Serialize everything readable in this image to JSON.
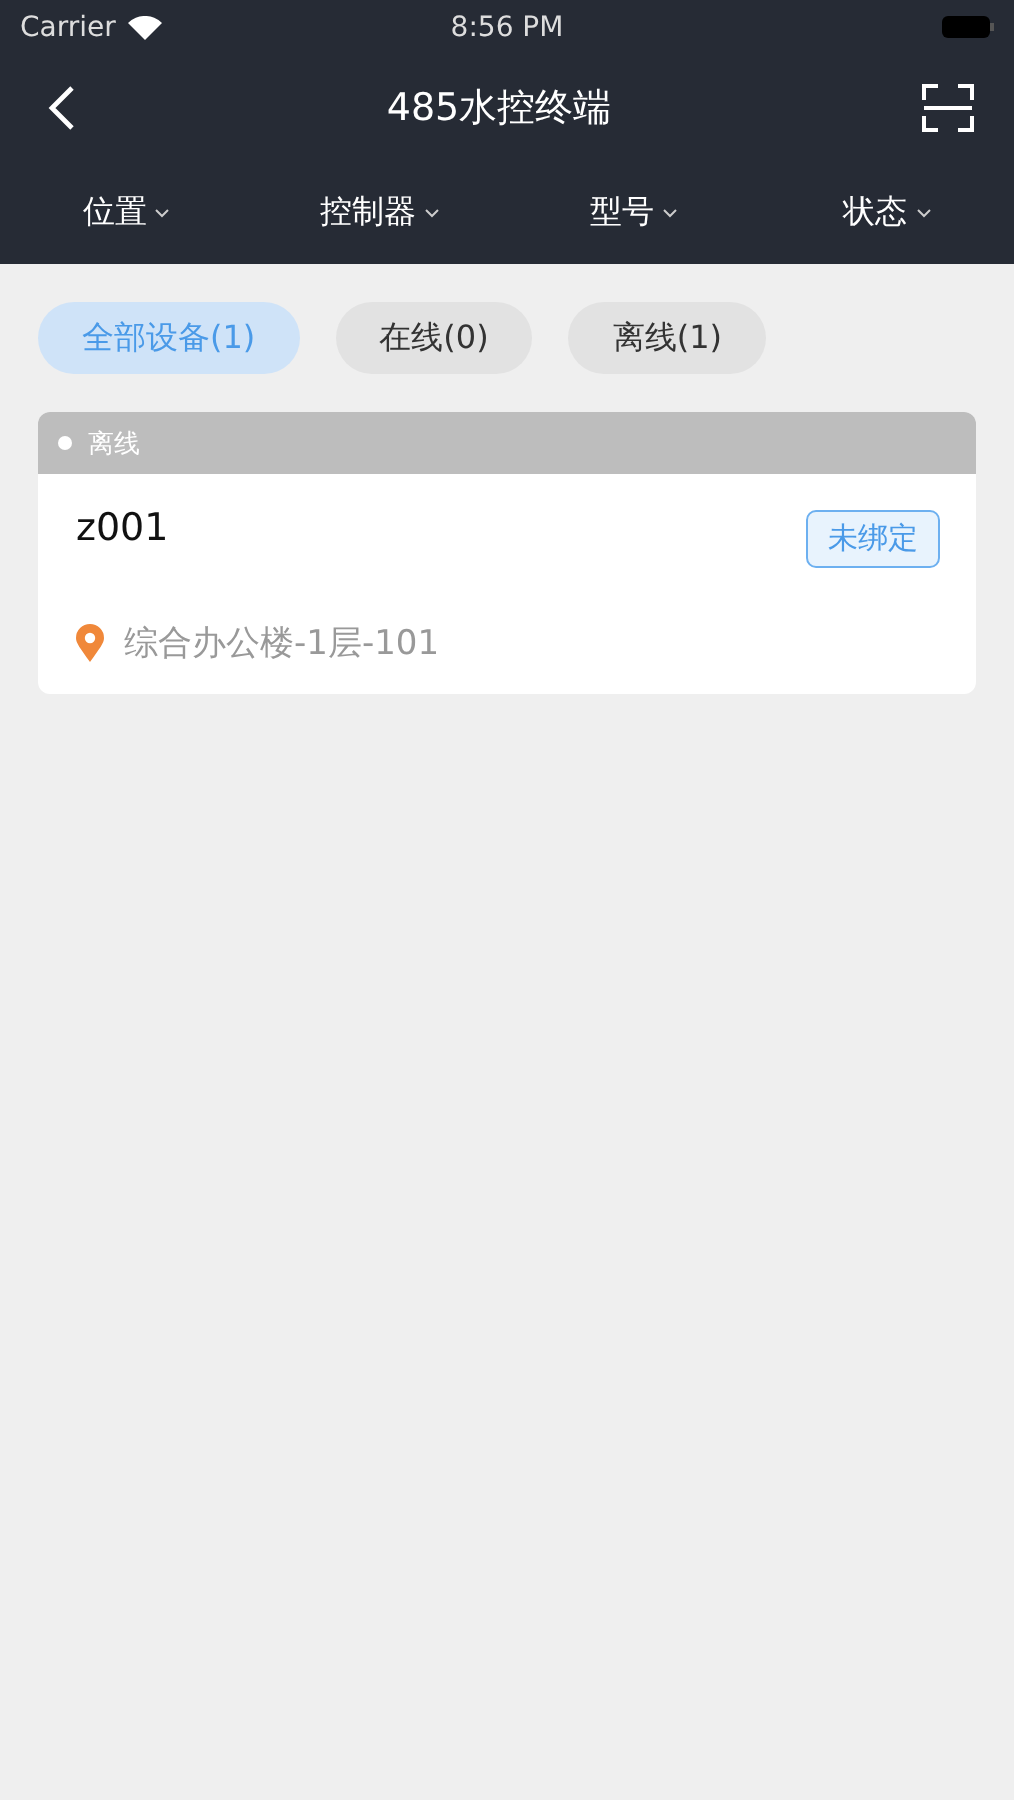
{
  "status_bar": {
    "carrier": "Carrier",
    "time": "8:56 PM"
  },
  "nav": {
    "title": "485水控终端"
  },
  "filters": [
    {
      "label": "位置"
    },
    {
      "label": "控制器"
    },
    {
      "label": "型号"
    },
    {
      "label": "状态"
    }
  ],
  "chips": [
    {
      "label": "全部设备(1)",
      "selected": true
    },
    {
      "label": "在线(0)",
      "selected": false
    },
    {
      "label": "离线(1)",
      "selected": false
    }
  ],
  "devices": [
    {
      "status": "离线",
      "online": false,
      "name": "z001",
      "badge": "未绑定",
      "location": "综合办公楼-1层-101"
    }
  ]
}
